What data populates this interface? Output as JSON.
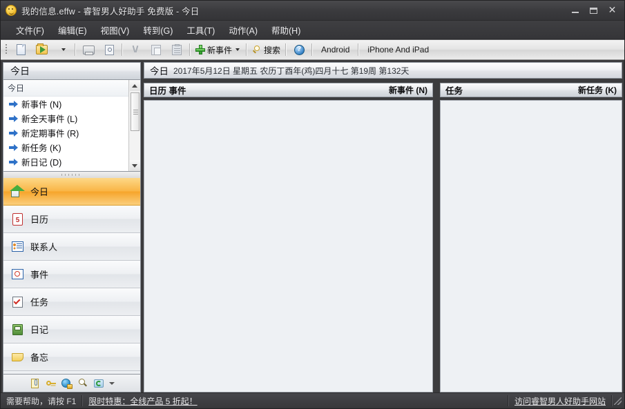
{
  "window": {
    "title": "我的信息.effw - 睿智男人好助手 免费版 - 今日",
    "icon": "smiley-icon",
    "minimize_label": "最小化",
    "maximize_label": "最大化",
    "close_label": "×"
  },
  "menubar": {
    "items": [
      {
        "name": "file",
        "label": "文件(F)"
      },
      {
        "name": "edit",
        "label": "编辑(E)"
      },
      {
        "name": "view",
        "label": "视图(V)"
      },
      {
        "name": "goto",
        "label": "转到(G)"
      },
      {
        "name": "tools",
        "label": "工具(T)"
      },
      {
        "name": "actions",
        "label": "动作(A)"
      },
      {
        "name": "help",
        "label": "帮助(H)"
      }
    ]
  },
  "toolbar": {
    "new_event_label": "新事件",
    "search_label": "搜索",
    "help_glyph": "?",
    "android_label": "Android",
    "iphone_label": "iPhone And iPad",
    "icons": [
      "new-document-icon",
      "open-file-icon",
      "export-icon",
      "print-preview-icon",
      "cut-icon",
      "copy-icon",
      "paste-icon",
      "add-icon",
      "search-icon",
      "help-icon"
    ]
  },
  "sidebar": {
    "pane_title": "今日",
    "task_group_label": "今日",
    "tasks": [
      {
        "name": "new-event",
        "label": "新事件 (N)"
      },
      {
        "name": "new-allday-event",
        "label": "新全天事件 (L)"
      },
      {
        "name": "new-recurring-event",
        "label": "新定期事件 (R)"
      },
      {
        "name": "new-task",
        "label": "新任务 (K)"
      },
      {
        "name": "new-diary",
        "label": "新日记 (D)"
      }
    ],
    "nav_items": [
      {
        "name": "today",
        "label": "今日",
        "icon": "home-icon",
        "selected": true
      },
      {
        "name": "calendar",
        "label": "日历",
        "icon": "calendar-icon",
        "selected": false
      },
      {
        "name": "contacts",
        "label": "联系人",
        "icon": "contacts-icon",
        "selected": false
      },
      {
        "name": "events",
        "label": "事件",
        "icon": "event-icon",
        "selected": false
      },
      {
        "name": "tasks",
        "label": "任务",
        "icon": "task-icon",
        "selected": false
      },
      {
        "name": "diary",
        "label": "日记",
        "icon": "diary-icon",
        "selected": false
      },
      {
        "name": "notes",
        "label": "备忘",
        "icon": "note-icon",
        "selected": false
      }
    ],
    "bottom_icons": [
      "clipboard-icon",
      "password-key-icon",
      "web-lock-icon",
      "find-icon",
      "sync-icon",
      "chevron-down-icon"
    ]
  },
  "main": {
    "daybar": {
      "today_label": "今日",
      "date_text": "2017年5月12日 星期五 农历丁酉年(鸡)四月十七 第19周 第132天"
    },
    "calendar_panel": {
      "title": "日历 事件",
      "new_button": "新事件 (N)"
    },
    "task_panel": {
      "title": "任务",
      "new_button": "新任务 (K)"
    }
  },
  "statusbar": {
    "help_hint": "需要帮助，请按 F1",
    "promo_link": "限时特惠：全线产品 5 折起！",
    "website_link": "访问睿智男人好助手网站"
  },
  "colors": {
    "selected_nav": "#f9b647",
    "titlebar": "#3b3b3e",
    "arrow_blue": "#2f72c8",
    "panel_bg": "#eef1f4"
  }
}
